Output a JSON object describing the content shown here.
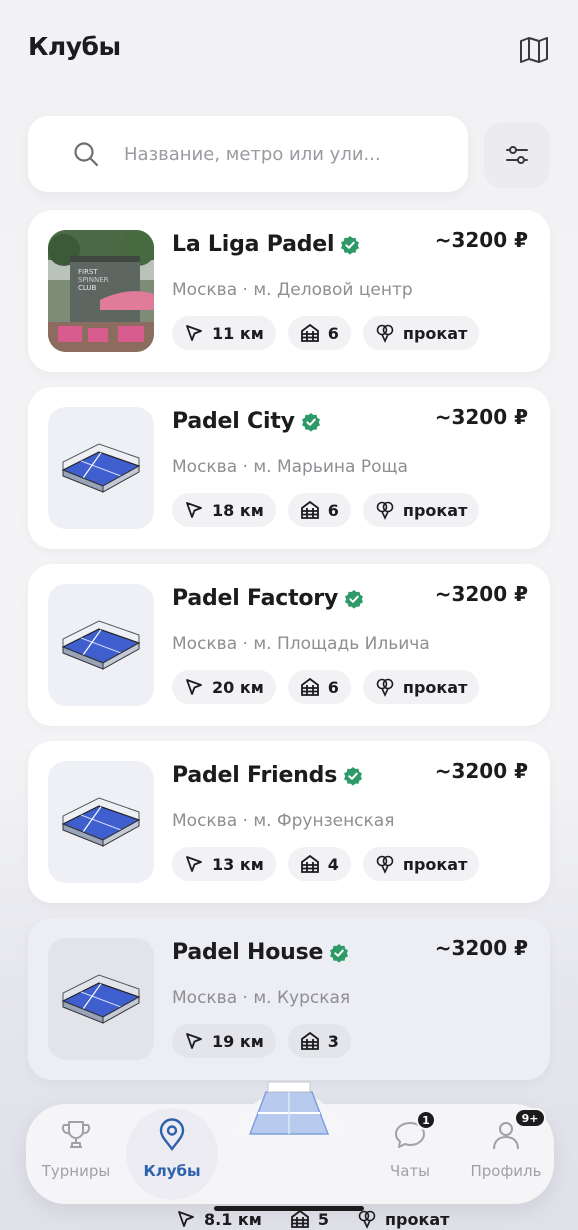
{
  "header": {
    "title": "Клубы",
    "map_icon": "map-icon"
  },
  "search": {
    "placeholder": "Название, метро или ули...",
    "value": ""
  },
  "accent_color": "#2f62ad",
  "verified_color": "#2e9a68",
  "clubs": [
    {
      "name": "La Liga Padel",
      "price": "~3200 ₽",
      "location": "Москва · м. Деловой центр",
      "distance": "11 км",
      "courts": "6",
      "rental": "прокат"
    },
    {
      "name": "Padel City",
      "price": "~3200 ₽",
      "location": "Москва · м. Марьина Роща",
      "distance": "18 км",
      "courts": "6",
      "rental": "прокат"
    },
    {
      "name": "Padel Factory",
      "price": "~3200 ₽",
      "location": "Москва · м. Площадь Ильича",
      "distance": "20 км",
      "courts": "6",
      "rental": "прокат"
    },
    {
      "name": "Padel Friends",
      "price": "~3200 ₽",
      "location": "Москва · м. Фрунзенская",
      "distance": "13 км",
      "courts": "4",
      "rental": "прокат"
    },
    {
      "name": "Padel House",
      "price": "~3200 ₽",
      "location": "Москва · м. Курская",
      "distance": "19 км",
      "courts": "3"
    },
    {
      "distance": "8.1 км",
      "courts": "5",
      "rental": "прокат"
    }
  ],
  "tabbar": {
    "tabs": [
      {
        "label": "Турниры",
        "icon": "trophy-icon"
      },
      {
        "label": "Клубы",
        "icon": "location-pin-icon",
        "active": true
      },
      {
        "label": "Чаты",
        "icon": "chat-icon",
        "badge": "1"
      },
      {
        "label": "Профиль",
        "icon": "profile-icon",
        "badge": "9+"
      }
    ]
  }
}
